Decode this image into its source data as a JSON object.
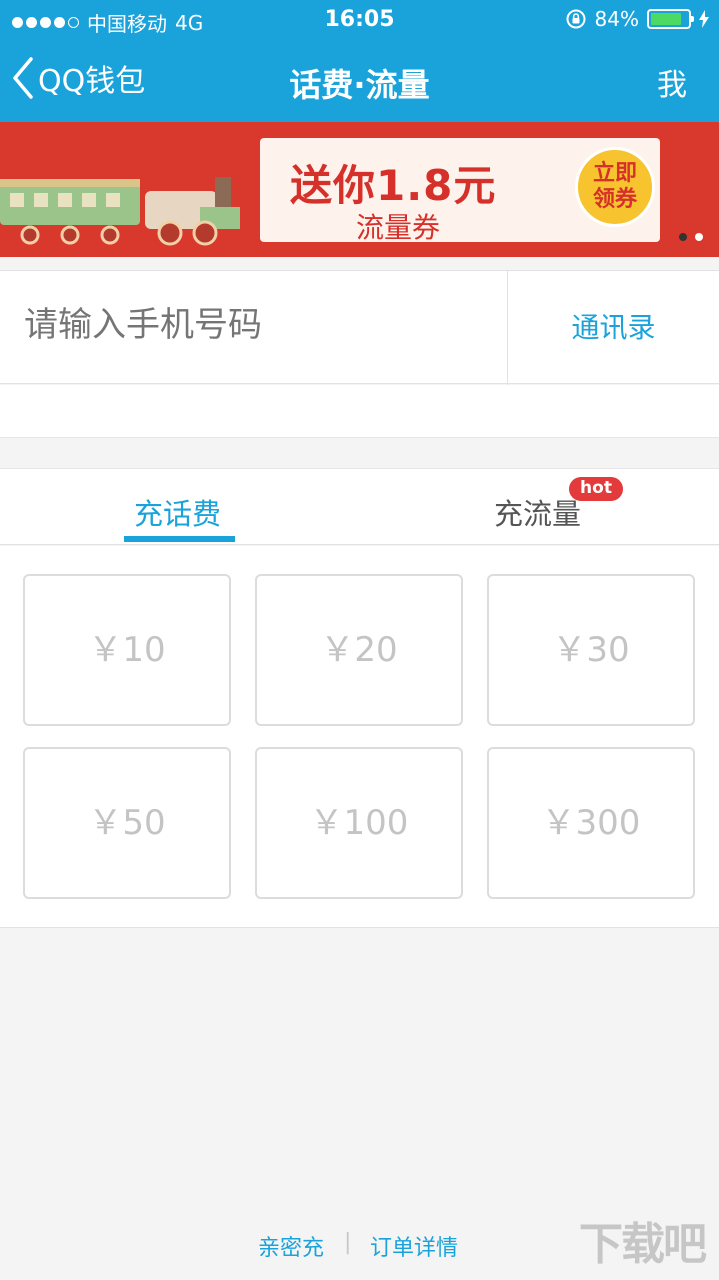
{
  "status_bar": {
    "carrier": "中国移动",
    "network": "4G",
    "time": "16:05",
    "battery_percent": "84%",
    "battery_level": 0.84,
    "signal_bars_filled": 4,
    "signal_bars_total": 5
  },
  "nav": {
    "back_label": "QQ钱包",
    "title": "话费·流量",
    "me_label": "我"
  },
  "banner": {
    "headline": "送你1.8元",
    "subline": "流量券",
    "cta": "立即领券",
    "pages": 2,
    "active_page": 2
  },
  "phone_input": {
    "placeholder": "请输入手机号码",
    "value": "",
    "contacts_label": "通讯录"
  },
  "tabs": [
    {
      "label": "充话费",
      "active": true
    },
    {
      "label": "充流量",
      "active": false,
      "badge": "hot"
    }
  ],
  "amounts": [
    "￥10",
    "￥20",
    "￥30",
    "￥50",
    "￥100",
    "￥300"
  ],
  "footer": {
    "link1": "亲密充",
    "separator": "|",
    "link2": "订单详情"
  },
  "watermark": "下载吧",
  "colors": {
    "primary": "#1aa3db",
    "banner_red": "#d9392d",
    "hot_badge": "#e33b3b",
    "background": "#f4f4f4"
  }
}
